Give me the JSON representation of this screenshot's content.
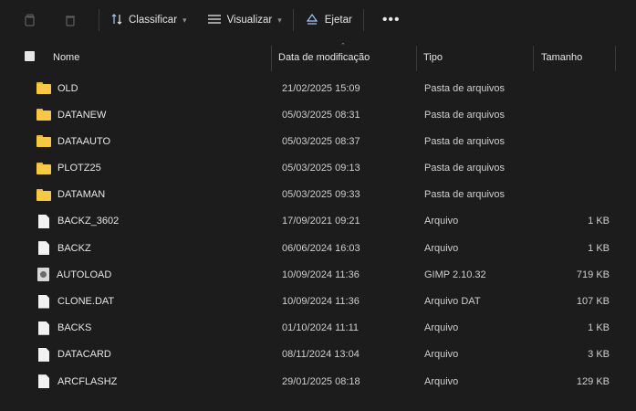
{
  "toolbar": {
    "sort_label": "Classificar",
    "view_label": "Visualizar",
    "eject_label": "Ejetar",
    "more_label": "•••"
  },
  "columns": {
    "name": "Nome",
    "date": "Data de modificação",
    "type": "Tipo",
    "size": "Tamanho"
  },
  "files": [
    {
      "name": "OLD",
      "date": "21/02/2025 15:09",
      "type": "Pasta de arquivos",
      "size": "",
      "icon": "folder-icon"
    },
    {
      "name": "DATANEW",
      "date": "05/03/2025 08:31",
      "type": "Pasta de arquivos",
      "size": "",
      "icon": "folder-icon"
    },
    {
      "name": "DATAAUTO",
      "date": "05/03/2025 08:37",
      "type": "Pasta de arquivos",
      "size": "",
      "icon": "folder-icon"
    },
    {
      "name": "PLOTZ25",
      "date": "05/03/2025 09:13",
      "type": "Pasta de arquivos",
      "size": "",
      "icon": "folder-icon"
    },
    {
      "name": "DATAMAN",
      "date": "05/03/2025 09:33",
      "type": "Pasta de arquivos",
      "size": "",
      "icon": "folder-icon"
    },
    {
      "name": "BACKZ_3602",
      "date": "17/09/2021 09:21",
      "type": "Arquivo",
      "size": "1 KB",
      "icon": "file-icon"
    },
    {
      "name": "BACKZ",
      "date": "06/06/2024 16:03",
      "type": "Arquivo",
      "size": "1 KB",
      "icon": "file-icon"
    },
    {
      "name": "AUTOLOAD",
      "date": "10/09/2024 11:36",
      "type": "GIMP 2.10.32",
      "size": "719 KB",
      "icon": "gimp-file-icon"
    },
    {
      "name": "CLONE.DAT",
      "date": "10/09/2024 11:36",
      "type": "Arquivo DAT",
      "size": "107 KB",
      "icon": "file-icon"
    },
    {
      "name": "BACKS",
      "date": "01/10/2024 11:11",
      "type": "Arquivo",
      "size": "1 KB",
      "icon": "file-icon"
    },
    {
      "name": "DATACARD",
      "date": "08/11/2024 13:04",
      "type": "Arquivo",
      "size": "3 KB",
      "icon": "file-icon"
    },
    {
      "name": "ARCFLASHZ",
      "date": "29/01/2025 08:18",
      "type": "Arquivo",
      "size": "129 KB",
      "icon": "file-icon"
    }
  ]
}
